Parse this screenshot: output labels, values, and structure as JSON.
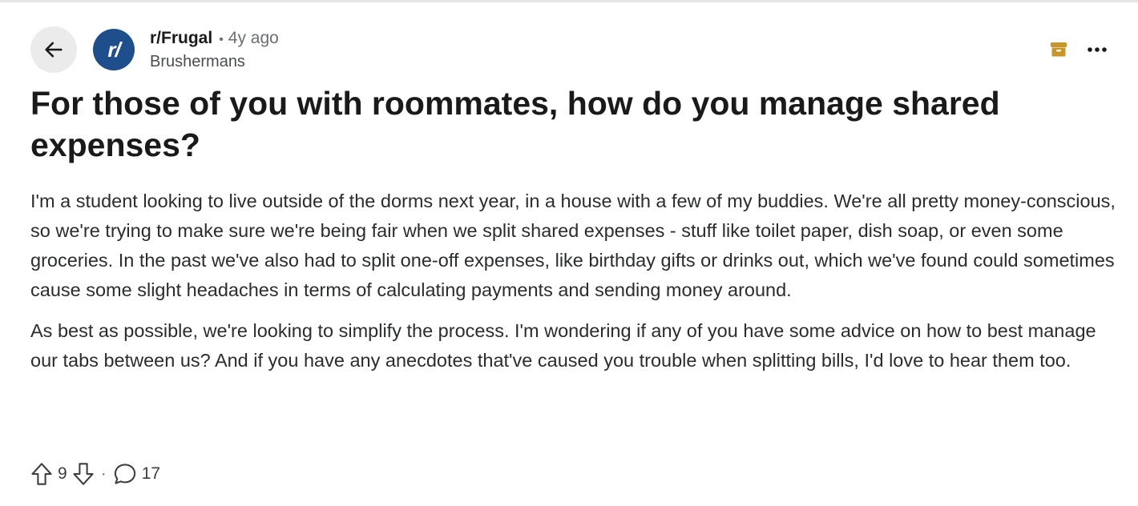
{
  "post": {
    "subreddit": "r/Frugal",
    "avatar_text": "r/",
    "separator": "•",
    "age": "4y ago",
    "author": "Brushermans",
    "title": "For those of you with roommates, how do you manage shared expenses?",
    "paragraphs": [
      "I'm a student looking to live outside of the dorms next year, in a house with a few of my buddies. We're all pretty money-conscious, so we're trying to make sure we're being fair when we split shared expenses - stuff like toilet paper, dish soap, or even some groceries. In the past we've also had to split one-off expenses, like birthday gifts or drinks out, which we've found could sometimes cause some slight headaches in terms of calculating payments and sending money around.",
      "As best as possible, we're looking to simplify the process. I'm wondering if any of you have some advice on how to best manage our tabs between us? And if you have any anecdotes that've caused you trouble when splitting bills, I'd love to hear them too."
    ],
    "vote_count": "9",
    "action_separator": "·",
    "comment_count": "17"
  },
  "icons": {
    "back": "arrow-left-icon",
    "archive": "archive-box-icon",
    "more": "more-horizontal-icon",
    "upvote": "upvote-arrow-icon",
    "downvote": "downvote-arrow-icon",
    "comment": "comment-bubble-icon"
  },
  "colors": {
    "subreddit_avatar": "#1e4f8c",
    "archive_icon": "#c8952b",
    "back_button_bg": "#ebebeb"
  }
}
